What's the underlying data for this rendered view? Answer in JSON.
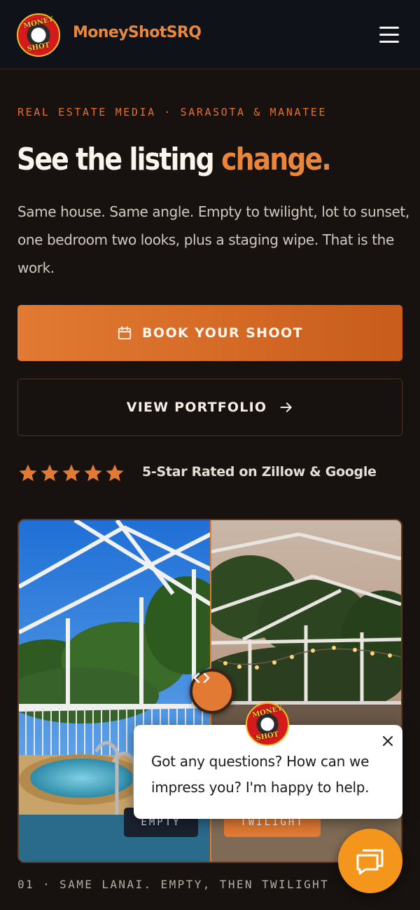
{
  "header": {
    "logo_top": "MONEY",
    "logo_bottom": "SHOT",
    "brand": "MoneyShotSRQ",
    "menu_icon": "hamburger-icon"
  },
  "hero": {
    "eyebrow": "REAL ESTATE MEDIA · SARASOTA & MANATEE",
    "headline_main": "See the listing ",
    "headline_accent": "change.",
    "lede": "Same house. Same angle. Empty to twilight, lot to sunset, one bedroom two looks, plus a staging wipe. That is the work."
  },
  "actions": {
    "book_label": "BOOK YOUR SHOOT",
    "book_icon": "calendar-icon",
    "portfolio_label": "VIEW PORTFOLIO",
    "portfolio_icon": "arrow-right-icon"
  },
  "rating": {
    "stars": 5,
    "text": "5-Star Rated on Zillow & Google"
  },
  "comparison": {
    "before_label": "EMPTY",
    "after_label": "TWILIGHT",
    "divider_position": 0.5,
    "caption": "01 · SAME LANAI. EMPTY, THEN TWILIGHT"
  },
  "chat": {
    "avatar_top": "MONEY",
    "avatar_bottom": "SHOT",
    "message": "Got any questions? How can we impress you? I'm happy to help."
  },
  "colors": {
    "accent": "#e27a33",
    "background": "#17120f",
    "header": "#0f1219",
    "chat_fab": "#f5961c"
  }
}
